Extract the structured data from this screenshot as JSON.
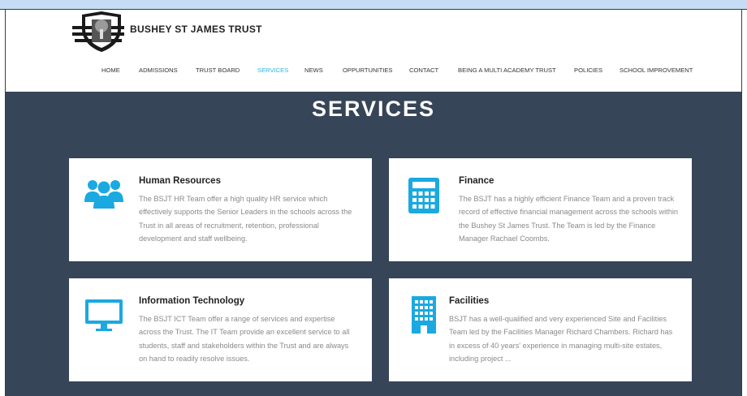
{
  "header": {
    "site_title": "BUSHEY ST JAMES TRUST"
  },
  "nav": {
    "items": [
      {
        "label": "HOME"
      },
      {
        "label": "ADMISSIONS"
      },
      {
        "label": "TRUST BOARD"
      },
      {
        "label": "SERVICES",
        "active": true
      },
      {
        "label": "NEWS"
      },
      {
        "label": "OPPURTUNITIES"
      },
      {
        "label": "CONTACT"
      },
      {
        "label": "BEING A MULTI ACADEMY TRUST"
      },
      {
        "label": "POLICIES"
      },
      {
        "label": "SCHOOL IMPROVEMENT"
      }
    ]
  },
  "main": {
    "title": "SERVICES",
    "cards": [
      {
        "icon": "people-icon",
        "title": "Human Resources",
        "text": "The BSJT HR Team offer a high quality HR service which effectively supports the Senior Leaders in the schools across the Trust in all areas of recruitment, retention, professional development and staff wellbeing."
      },
      {
        "icon": "calculator-icon",
        "title": "Finance",
        "text": "The BSJT has a highly efficient Finance Team and a proven track record of effective financial management across the schools within the Bushey St James Trust. The Team is led by the Finance Manager Rachael Coombs."
      },
      {
        "icon": "monitor-icon",
        "title": "Information Technology",
        "text": "The BSJT ICT Team offer a range of services and expertise across the Trust. The IT Team provide an excellent service to all students, staff and stakeholders within the Trust and are always on hand to readily resolve issues."
      },
      {
        "icon": "building-icon",
        "title": "Facilities",
        "text": "BSJT has a well-qualified and very experienced Site and Facilities Team led by the Facilities Manager Richard Chambers. Richard has in excess of 40 years' experience in managing multi-site estates, including project ..."
      }
    ]
  },
  "colors": {
    "accent": "#2fb3e0",
    "panel_bg": "#364557",
    "icon": "#1aa9e0"
  }
}
